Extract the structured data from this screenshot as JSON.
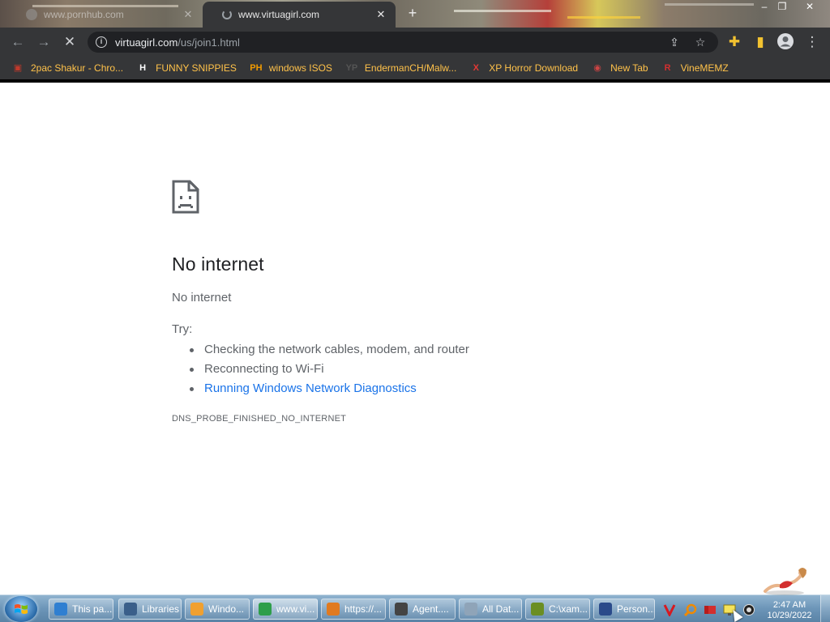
{
  "tabs": [
    {
      "title": "www.pornhub.com",
      "active": false
    },
    {
      "title": "www.virtuagirl.com",
      "active": true
    }
  ],
  "window_controls": {
    "minimize": "–",
    "restore": "❐",
    "close": "✕"
  },
  "toolbar": {
    "url_host": "virtuagirl.com",
    "url_path": "/us/join1.html",
    "back_icon": "back-arrow-icon",
    "forward_icon": "forward-arrow-icon",
    "stop_icon": "stop-icon"
  },
  "bookmarks": [
    {
      "label": "2pac Shakur - Chro...",
      "icon": "2pac-favicon",
      "color": "#c0392b",
      "glyph": "▣"
    },
    {
      "label": "FUNNY SNIPPIES",
      "icon": "h-favicon",
      "color": "#ffffff",
      "glyph": "H"
    },
    {
      "label": "windows ISOS",
      "icon": "ph-favicon",
      "color": "#f29b00",
      "glyph": "PH"
    },
    {
      "label": "EndermanCH/Malw...",
      "icon": "yp-favicon",
      "color": "#555555",
      "glyph": "YP"
    },
    {
      "label": "XP Horror Download",
      "icon": "x-favicon",
      "color": "#e53935",
      "glyph": "X"
    },
    {
      "label": "New Tab",
      "icon": "globe-favicon",
      "color": "#cc4444",
      "glyph": "◉"
    },
    {
      "label": "VineMEMZ",
      "icon": "r-favicon",
      "color": "#d32f2f",
      "glyph": "R"
    }
  ],
  "error_page": {
    "heading": "No internet",
    "subtitle": "No internet",
    "try_label": "Try:",
    "suggestions": [
      {
        "text": "Checking the network cables, modem, and router",
        "link": false
      },
      {
        "text": "Reconnecting to Wi-Fi",
        "link": false
      },
      {
        "text": "Running Windows Network Diagnostics",
        "link": true
      }
    ],
    "error_code": "DNS_PROBE_FINISHED_NO_INTERNET"
  },
  "taskbar": {
    "items": [
      {
        "label": "This pa...",
        "color": "#2f7fd1"
      },
      {
        "label": "Libraries",
        "color": "#3a5f8a"
      },
      {
        "label": "Windo...",
        "color": "#f0a030"
      },
      {
        "label": "www.vi...",
        "color": "#2e9e4a",
        "active": true
      },
      {
        "label": "https://...",
        "color": "#e07a20"
      },
      {
        "label": "Agent....",
        "color": "#444444"
      },
      {
        "label": "All Dat...",
        "color": "#8fa4b8"
      },
      {
        "label": "C:\\xam...",
        "color": "#6b8e23"
      },
      {
        "label": "Person...",
        "color": "#2a4a8a"
      }
    ],
    "clock_time": "2:47 AM",
    "clock_date": "10/29/2022"
  }
}
